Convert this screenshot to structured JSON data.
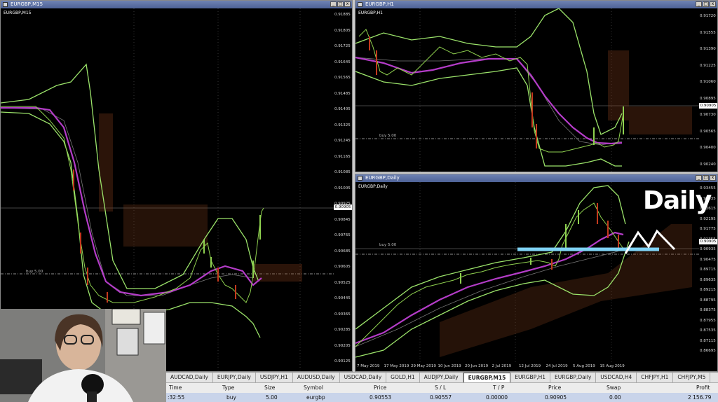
{
  "windows": {
    "m15": {
      "title": "EURGBP,M15",
      "symbol_label": "EURGBP,M15",
      "buy_label": "buy 5.00",
      "current_price": "0.90905",
      "price_labels": [
        "0.91885",
        "0.91805",
        "0.91725",
        "0.91645",
        "0.91565",
        "0.91485",
        "0.91405",
        "0.91325",
        "0.91245",
        "0.91165",
        "0.91085",
        "0.91005",
        "0.90925",
        "0.90845",
        "0.90765",
        "0.90685",
        "0.90605",
        "0.90525",
        "0.90445",
        "0.90365",
        "0.90285",
        "0.90205",
        "0.90125"
      ]
    },
    "h1": {
      "title": "EURGBP,H1",
      "symbol_label": "EURGBP,H1",
      "buy_label": "buy 5.00",
      "current_price": "0.90905",
      "price_labels": [
        "0.91720",
        "0.91555",
        "0.91390",
        "0.91225",
        "0.91060",
        "0.90895",
        "0.90730",
        "0.90565",
        "0.90400",
        "0.90240"
      ]
    },
    "daily": {
      "title": "EURGBP,Daily",
      "symbol_label": "EURGBP,Daily",
      "buy_label": "buy 5.00",
      "current_price": "0.90905",
      "price_labels": [
        "0.93455",
        "0.93035",
        "0.92615",
        "0.92195",
        "0.91775",
        "0.91355",
        "0.90935",
        "0.90475",
        "0.89715",
        "0.89635",
        "0.89215",
        "0.88795",
        "0.88375",
        "0.87955",
        "0.87535",
        "0.87115",
        "0.86695"
      ],
      "date_labels": [
        "7 May 2019",
        "17 May 2019",
        "29 May 2019",
        "10 Jun 2019",
        "20 Jun 2019",
        "2 Jul 2019",
        "12 Jul 2019",
        "24 Jul 2019",
        "5 Aug 2019",
        "15 Aug 2019"
      ]
    }
  },
  "overlay_text": "Daily",
  "tabs": [
    "AUDCAD,Daily",
    "EURJPY,Daily",
    "USDJPY,H1",
    "AUDUSD,Daily",
    "USDCAD,Daily",
    "GOLD,H1",
    "AUDJPY,Daily",
    "EURGBP,M15",
    "EURGBP,H1",
    "EURGBP,Daily",
    "USDCAD,H4",
    "CHFJPY,H1",
    "CHFJPY,M5"
  ],
  "active_tab": "EURGBP,M15",
  "trade_table": {
    "headers": {
      "time": "Time",
      "type": "Type",
      "size": "Size",
      "symbol": "Symbol",
      "price": "Price",
      "sl": "S / L",
      "tp": "T / P",
      "price2": "Price",
      "swap": "Swap",
      "profit": "Profit"
    },
    "row": {
      "time": ":32:55",
      "type": "buy",
      "size": "5.00",
      "symbol": "eurgbp",
      "price": "0.90553",
      "sl": "0.90557",
      "tp": "0.00000",
      "price2": "0.90905",
      "swap": "0.00",
      "profit": "2 156.79"
    }
  },
  "colors": {
    "bollinger": "#9be36a",
    "ma": "#b43cc8",
    "bull": "#8fd14f",
    "bear": "#c43a1e",
    "highlight": "#7fd3f5"
  }
}
